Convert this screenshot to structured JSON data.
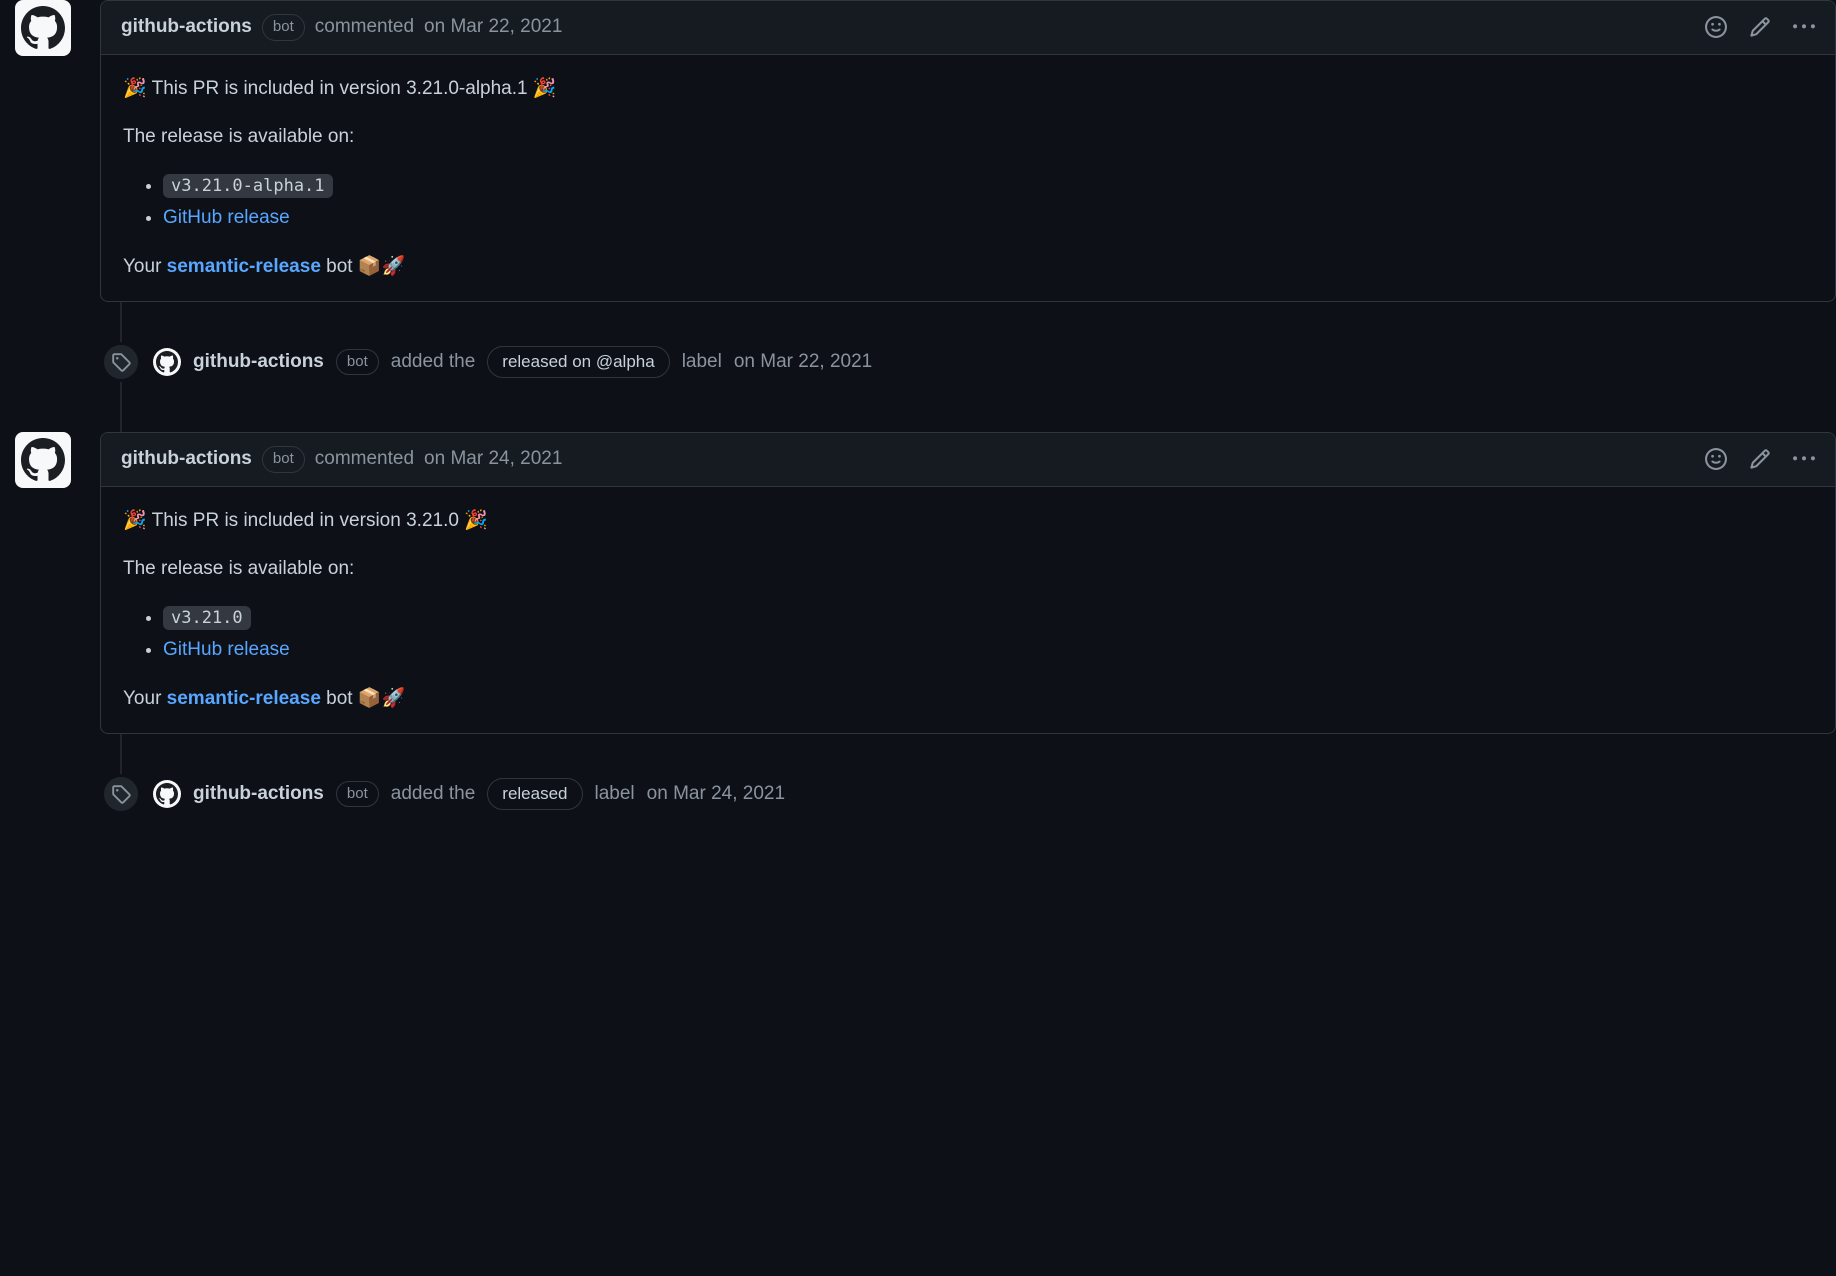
{
  "badges": {
    "bot": "bot"
  },
  "comments": [
    {
      "author": "github-actions",
      "action": "commented",
      "date": "on Mar 22, 2021",
      "body": {
        "line1_pre": "🎉 This PR is included in version ",
        "version": "3.21.0-alpha.1",
        "line1_post": " 🎉",
        "line2": "The release is available on:",
        "tag": "v3.21.0-alpha.1",
        "release_link": "GitHub release",
        "footer_pre": "Your ",
        "footer_link": "semantic-release",
        "footer_post": " bot 📦🚀"
      }
    },
    {
      "author": "github-actions",
      "action": "commented",
      "date": "on Mar 24, 2021",
      "body": {
        "line1_pre": "🎉 This PR is included in version ",
        "version": "3.21.0",
        "line1_post": " 🎉",
        "line2": "The release is available on:",
        "tag": "v3.21.0",
        "release_link": "GitHub release",
        "footer_pre": "Your ",
        "footer_link": "semantic-release",
        "footer_post": " bot 📦🚀"
      }
    }
  ],
  "events": [
    {
      "author": "github-actions",
      "verb": "added the",
      "label": "released on @alpha",
      "suffix": "label",
      "date": "on Mar 22, 2021"
    },
    {
      "author": "github-actions",
      "verb": "added the",
      "label": "released",
      "suffix": "label",
      "date": "on Mar 24, 2021"
    }
  ]
}
